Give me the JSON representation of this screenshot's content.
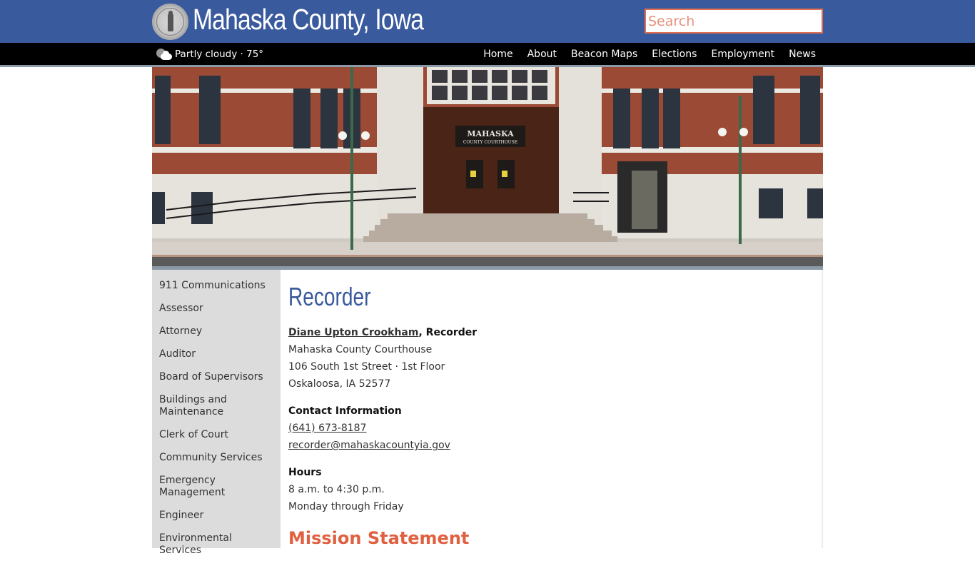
{
  "header": {
    "site_title": "Mahaska County, Iowa",
    "search_placeholder": "Search",
    "weather": {
      "icon": "partly-cloudy-icon",
      "text": "Partly cloudy · 75°"
    },
    "nav": [
      {
        "label": "Home"
      },
      {
        "label": "About"
      },
      {
        "label": "Beacon Maps"
      },
      {
        "label": "Elections"
      },
      {
        "label": "Employment"
      },
      {
        "label": "News"
      }
    ]
  },
  "hero": {
    "sign_line1": "MAHASKA",
    "sign_line2": "COUNTY COURTHOUSE"
  },
  "sidebar": {
    "items": [
      {
        "label": "911 Communications"
      },
      {
        "label": "Assessor"
      },
      {
        "label": "Attorney"
      },
      {
        "label": "Auditor"
      },
      {
        "label": "Board of Supervisors"
      },
      {
        "label": "Buildings and Maintenance"
      },
      {
        "label": "Clerk of Court"
      },
      {
        "label": "Community Services"
      },
      {
        "label": "Emergency Management"
      },
      {
        "label": "Engineer"
      },
      {
        "label": "Environmental Services"
      }
    ]
  },
  "content": {
    "title": "Recorder",
    "official_name": "Diane Upton Crookham",
    "official_role": ", Recorder",
    "address": [
      "Mahaska County Courthouse",
      "106 South 1st Street · 1st Floor",
      "Oskaloosa, IA 52577"
    ],
    "contact_heading": "Contact Information",
    "phone": "(641) 673-8187",
    "email": "recorder@mahaskacountyia.gov",
    "hours_heading": "Hours",
    "hours": [
      "8 a.m. to 4:30 p.m.",
      "Monday through Friday"
    ],
    "mission_heading": "Mission Statement"
  },
  "colors": {
    "header_blue": "#3a5a9e",
    "nav_black": "#000000",
    "accent_orange": "#e06040",
    "sidebar_gray": "#dcdcdc"
  }
}
